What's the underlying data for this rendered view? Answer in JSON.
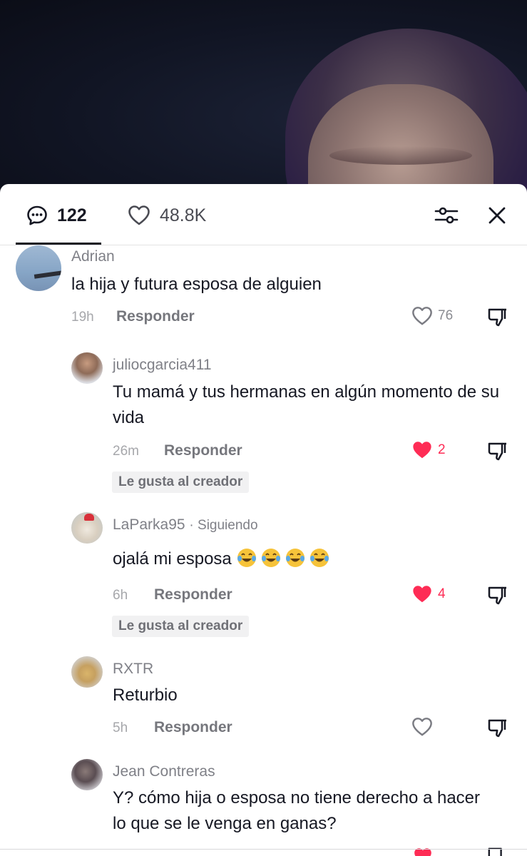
{
  "tabs": {
    "comments_count": "122",
    "likes_count": "48.8K"
  },
  "comments": [
    {
      "username": "Adrian",
      "text": "la hija y futura esposa de alguien",
      "time": "19h",
      "reply_label": "Responder",
      "likes": "76",
      "liked": false
    },
    {
      "username": "juliocgarcia411",
      "text": "Tu mamá y tus hermanas en algún momento de su vida",
      "time": "26m",
      "reply_label": "Responder",
      "likes": "2",
      "liked": true,
      "badge": "Le gusta al creador"
    },
    {
      "username": "LaParka95",
      "following_label": "Siguiendo",
      "text": "ojalá mi esposa",
      "text_emojis": [
        "face-with-tears-of-joy",
        "face-with-tears-of-joy",
        "face-with-tears-of-joy",
        "face-with-tears-of-joy"
      ],
      "time": "6h",
      "reply_label": "Responder",
      "likes": "4",
      "liked": true,
      "badge": "Le gusta al creador"
    },
    {
      "username": "RXTR",
      "text": "Returbio",
      "time": "5h",
      "reply_label": "Responder",
      "likes": "",
      "liked": false
    },
    {
      "username": "Jean Contreras",
      "text": "Y? cómo hija o esposa no tiene derecho a hacer lo que se le venga en ganas?"
    }
  ],
  "icons": {
    "comments_tab": "chat-bubble-icon",
    "likes_tab": "heart-outline-icon",
    "filter": "sliders-icon",
    "close": "close-icon",
    "like": "heart-icon",
    "dislike": "thumbs-down-icon"
  },
  "colors": {
    "accent_red": "#fe2c55",
    "text_primary": "#161823",
    "text_secondary": "#7f8087"
  }
}
